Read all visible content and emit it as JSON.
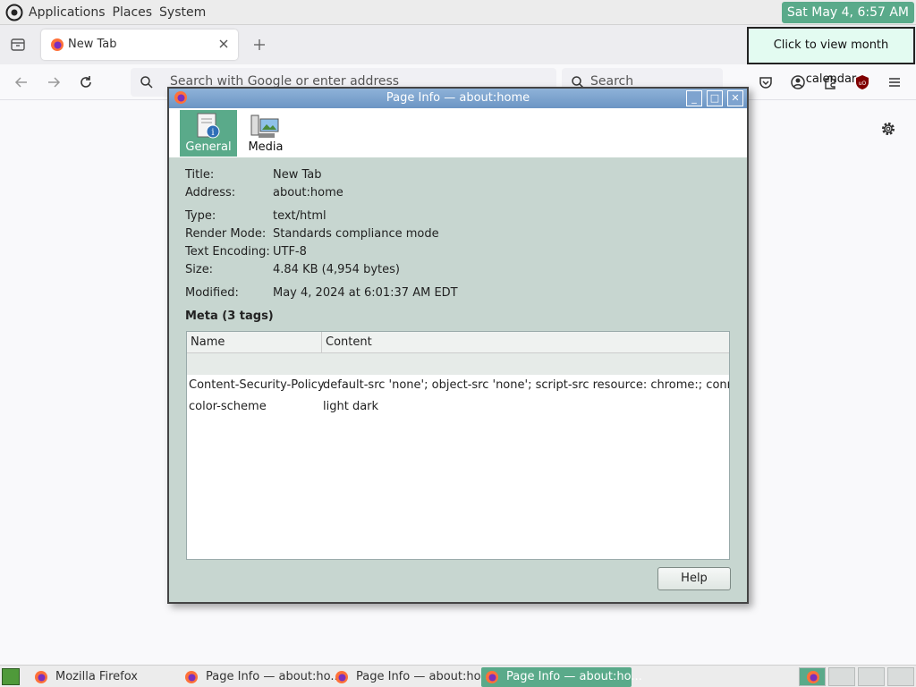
{
  "top_panel": {
    "menus": [
      "Applications",
      "Places",
      "System"
    ],
    "clock": "Sat May 4,  6:57 AM",
    "clock_tooltip": "Click to view month calendar"
  },
  "browser": {
    "tab_label": "New Tab",
    "url_placeholder": "Search with Google or enter address",
    "search_placeholder": "Search"
  },
  "dialog": {
    "title": "Page Info — about:home",
    "tabs": [
      {
        "label": "General",
        "icon": "general-info-icon",
        "selected": true
      },
      {
        "label": "Media",
        "icon": "media-icon",
        "selected": false
      }
    ],
    "fields": [
      {
        "key": "Title:",
        "value": "New Tab"
      },
      {
        "key": "Address:",
        "value": "about:home"
      },
      {
        "key": "Type:",
        "value": "text/html"
      },
      {
        "key": "Render Mode:",
        "value": "Standards compliance mode"
      },
      {
        "key": "Text Encoding:",
        "value": "UTF-8"
      },
      {
        "key": "Size:",
        "value": "4.84 KB (4,954 bytes)"
      },
      {
        "key": "Modified:",
        "value": "May 4, 2024 at 6:01:37 AM EDT"
      }
    ],
    "meta_title": "Meta (3 tags)",
    "meta_columns": [
      "Name",
      "Content"
    ],
    "meta_rows": [
      {
        "name": "Content-Security-Policy",
        "content": "default-src 'none'; object-src 'none'; script-src resource: chrome:; connect-src..."
      },
      {
        "name": "color-scheme",
        "content": "light dark"
      }
    ],
    "help_label": "Help"
  },
  "taskbar": {
    "tasks": [
      {
        "label": "Mozilla Firefox",
        "active": false
      },
      {
        "label": "Page Info — about:ho...",
        "active": false
      },
      {
        "label": "Page Info — about:ho...",
        "active": false
      },
      {
        "label": "Page Info — about:ho...",
        "active": true
      }
    ]
  },
  "colors": {
    "accent": "#5aaa8a",
    "dialog_bg": "#c7d6d0",
    "titlebar": "#7ea3cf"
  }
}
